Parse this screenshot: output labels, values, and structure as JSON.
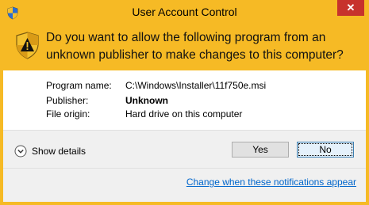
{
  "window": {
    "title": "User Account Control",
    "close_label": "✕",
    "accent_color": "#f6ba25",
    "close_color": "#c7322c"
  },
  "header": {
    "prompt": "Do you want to allow the following program from an unknown publisher to make changes to this computer?",
    "icon": "uac-shield-icon"
  },
  "program": {
    "name_label": "Program name:",
    "name_value": "C:\\Windows\\Installer\\11f750e.msi",
    "publisher_label": "Publisher:",
    "publisher_value": "Unknown",
    "origin_label": "File origin:",
    "origin_value": "Hard drive on this computer"
  },
  "footer": {
    "details_label": "Show details",
    "yes_label": "Yes",
    "no_label": "No",
    "notifications_link": "Change when these notifications appear",
    "link_color": "#0066cc"
  }
}
